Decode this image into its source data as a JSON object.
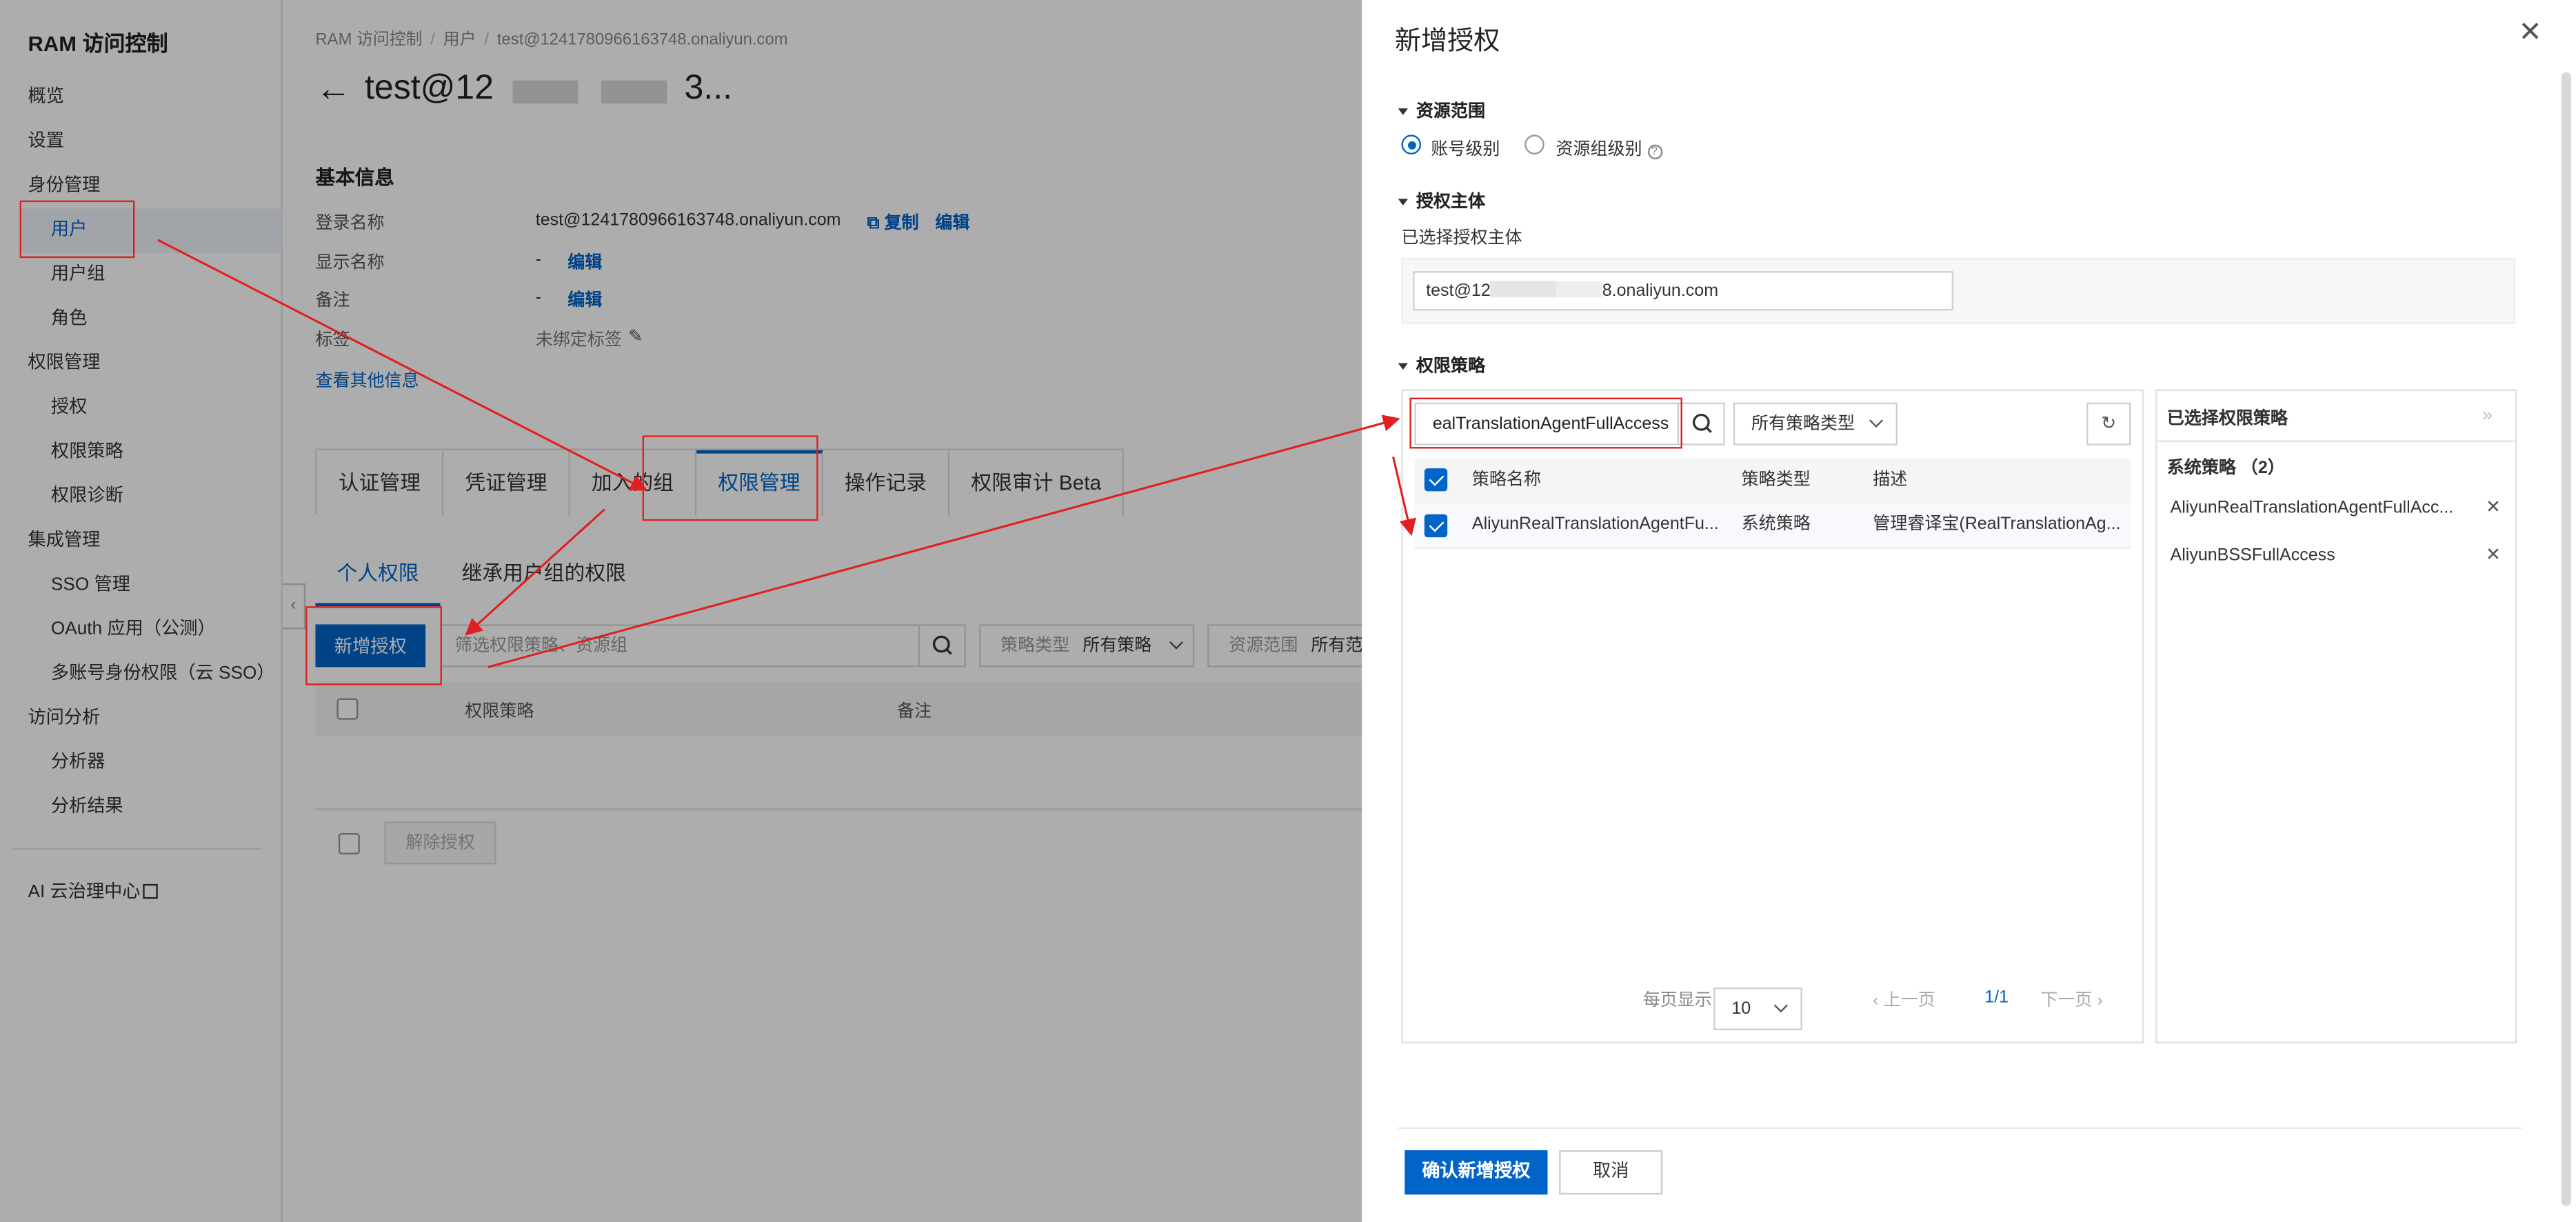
{
  "sidebar": {
    "title": "RAM 访问控制",
    "items": [
      {
        "label": "概览"
      },
      {
        "label": "设置"
      },
      {
        "label": "身份管理"
      },
      {
        "label": "用户"
      },
      {
        "label": "用户组"
      },
      {
        "label": "角色"
      },
      {
        "label": "权限管理"
      },
      {
        "label": "授权"
      },
      {
        "label": "权限策略"
      },
      {
        "label": "权限诊断"
      },
      {
        "label": "集成管理"
      },
      {
        "label": "SSO 管理"
      },
      {
        "label": "OAuth 应用（公测）"
      },
      {
        "label": "多账号身份权限（云 SSO）"
      },
      {
        "label": "访问分析"
      },
      {
        "label": "分析器"
      },
      {
        "label": "分析结果"
      }
    ],
    "footer_link": "AI 云治理中心"
  },
  "main": {
    "breadcrumb": [
      "RAM 访问控制",
      "用户",
      "test@1241780966163748.onaliyun.com"
    ],
    "title_prefix": "test@12",
    "title_suffix": "3...",
    "basic_info_heading": "基本信息",
    "info": {
      "login_name_label": "登录名称",
      "login_name_value": "test@1241780966163748.onaliyun.com",
      "copy": "复制",
      "edit": "编辑",
      "display_name_label": "显示名称",
      "display_name_value": "-",
      "remark_label": "备注",
      "remark_value": "-",
      "tag_label": "标签",
      "tag_value": "未绑定标签",
      "more_info": "查看其他信息"
    },
    "tabs": [
      "认证管理",
      "凭证管理",
      "加入的组",
      "权限管理",
      "操作记录",
      "权限审计 Beta"
    ],
    "subtabs": [
      "个人权限",
      "继承用户组的权限"
    ],
    "add_auth_button": "新增授权",
    "filter_placeholder": "筛选权限策略、资源组",
    "policy_type_label": "策略类型",
    "policy_type_value": "所有策略",
    "resource_scope_label": "资源范围",
    "resource_scope_value": "所有范",
    "table_headers": [
      "权限策略",
      "备注"
    ],
    "revoke_button": "解除授权"
  },
  "drawer": {
    "title": "新增授权",
    "resource_scope_heading": "资源范围",
    "scope_account": "账号级别",
    "scope_group": "资源组级别",
    "principal_heading": "授权主体",
    "principal_selected_label": "已选择授权主体",
    "principal_prefix": "test@12",
    "principal_suffix": "8.onaliyun.com",
    "policy_heading": "权限策略",
    "search_value": "ealTranslationAgentFullAccess",
    "policy_type_select": "所有策略类型",
    "table_headers": [
      "策略名称",
      "策略类型",
      "描述"
    ],
    "rows": [
      {
        "name": "AliyunRealTranslationAgentFu...",
        "type": "系统策略",
        "desc": "管理睿译宝(RealTranslationAg..."
      }
    ],
    "per_page_label": "每页显示",
    "per_page_value": "10",
    "prev": "上一页",
    "page": "1/1",
    "next": "下一页",
    "selected_heading": "已选择权限策略",
    "selected_group": "系统策略 （2）",
    "selected_items": [
      "AliyunRealTranslationAgentFullAcc...",
      "AliyunBSSFullAccess"
    ],
    "confirm_button": "确认新增授权",
    "cancel_button": "取消"
  },
  "colors": {
    "accent": "#0064c8",
    "annotation": "#e02020"
  }
}
